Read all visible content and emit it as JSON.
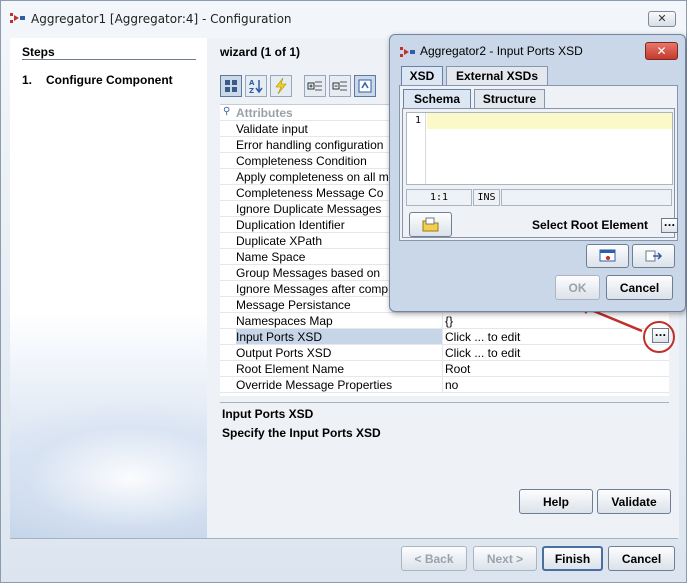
{
  "window": {
    "title": "Aggregator1 [Aggregator:4] - Configuration",
    "close_label": "✕"
  },
  "steps": {
    "header": "Steps",
    "items": [
      {
        "number": "1.",
        "label": "Configure Component"
      }
    ]
  },
  "wizard": {
    "title": "wizard (1 of 1)",
    "toolbar": [
      "categorized-icon",
      "sort-alpha-icon",
      "lightning-icon",
      "expand-icon",
      "collapse-icon",
      "help-icon"
    ]
  },
  "properties": {
    "category": "Attributes",
    "rows": [
      {
        "name": "Validate input",
        "value": ""
      },
      {
        "name": "Error handling configuration",
        "value": ""
      },
      {
        "name": "Completeness Condition",
        "value": ""
      },
      {
        "name": "Apply completeness on all m",
        "value": ""
      },
      {
        "name": "Completeness Message Co",
        "value": ""
      },
      {
        "name": "Ignore Duplicate Messages",
        "value": ""
      },
      {
        "name": "Duplication Identifier",
        "value": ""
      },
      {
        "name": "Duplicate XPath",
        "value": ""
      },
      {
        "name": "Name Space",
        "value": ""
      },
      {
        "name": "Group Messages based on",
        "value": ""
      },
      {
        "name": "Ignore Messages after comp",
        "value": ""
      },
      {
        "name": "Message Persistance",
        "value": ""
      },
      {
        "name": "Namespaces Map",
        "value": "{}"
      },
      {
        "name": "Input Ports XSD",
        "value": "Click ... to edit"
      },
      {
        "name": "Output Ports XSD",
        "value": "Click ... to edit"
      },
      {
        "name": "Root Element Name",
        "value": "Root"
      },
      {
        "name": "Override Message Properties",
        "value": "no"
      }
    ],
    "ellipsis_label": "..."
  },
  "description": {
    "title": "Input Ports XSD",
    "text": "Specify the Input Ports XSD"
  },
  "buttons": {
    "help": "Help",
    "validate": "Validate",
    "back": "< Back",
    "next": "Next >",
    "finish": "Finish",
    "cancel": "Cancel"
  },
  "dialog": {
    "title": "Aggregator2 - Input Ports XSD",
    "close_label": "✕",
    "tabs": [
      "XSD",
      "External XSDs"
    ],
    "subtabs": [
      "Schema",
      "Structure"
    ],
    "line_number": "1",
    "cursor_pos": "1:1",
    "mode": "INS",
    "select_root_label": "Select Root Element",
    "ellipsis_label": "...",
    "ok": "OK",
    "cancel": "Cancel"
  },
  "colors": {
    "selected_row": "#c7d5e8",
    "annotation_red": "#c0302b",
    "dialog_bg": "#c9d7e8",
    "editor_highlight": "#fbf9c8"
  }
}
